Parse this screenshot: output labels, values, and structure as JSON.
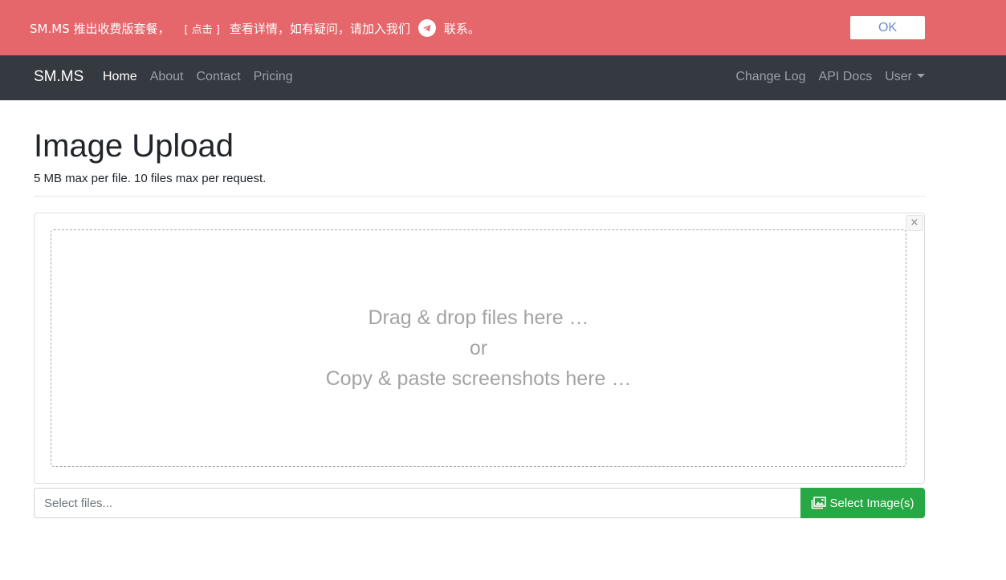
{
  "notice": {
    "text_before": "SM.MS 推出收费版套餐，",
    "link_label": "[ 点击 ]",
    "text_middle": "查看详情，如有疑问，请加入我们",
    "text_after": "联系。",
    "icon": "telegram-icon",
    "ok_label": "OK"
  },
  "navbar": {
    "brand": "SM.MS",
    "left_links": [
      "Home",
      "About",
      "Contact",
      "Pricing"
    ],
    "right_links": [
      "Change Log",
      "API Docs"
    ],
    "user_label": "User"
  },
  "main": {
    "title": "Image Upload",
    "subtitle": "5 MB max per file. 10 files max per request.",
    "close_label": "×",
    "drop_line1": "Drag & drop files here …",
    "drop_line2": "or",
    "drop_line3": "Copy & paste screenshots here …",
    "file_placeholder": "Select files...",
    "select_button": "Select Image(s)",
    "select_icon": "images-icon"
  },
  "colors": {
    "notice_bg": "#e5666b",
    "navbar_bg": "#343a40",
    "button_green": "#28a745"
  }
}
